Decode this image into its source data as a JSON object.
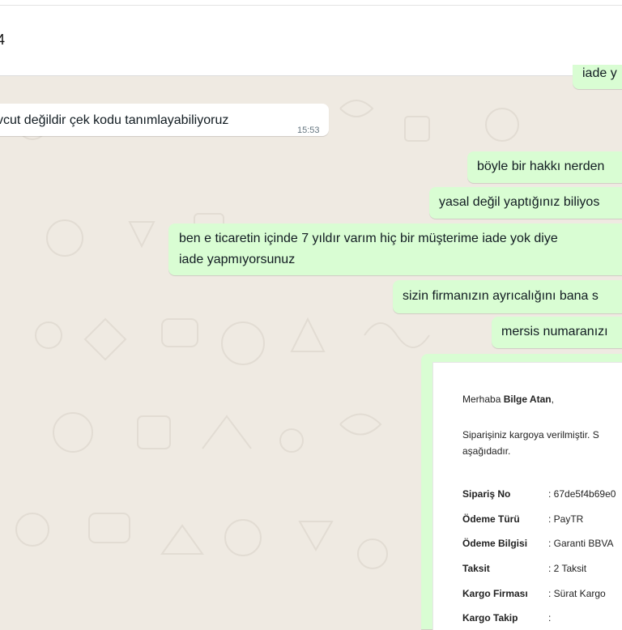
{
  "header": {
    "title": "4"
  },
  "colors": {
    "outgoing": "#d9fdd3",
    "incoming": "#ffffff",
    "wallpaper": "#efeae2"
  },
  "messages": [
    {
      "direction": "out",
      "text": "iade y"
    },
    {
      "direction": "in",
      "text": "vcut değildir çek kodu tanımlayabiliyoruz",
      "time": "15:53"
    },
    {
      "direction": "out",
      "text": "böyle bir hakkı nerden"
    },
    {
      "direction": "out",
      "text": "yasal değil yaptığınız biliyos"
    },
    {
      "direction": "out",
      "line1": "ben e ticaretin içinde 7 yıldır varım hiç bir müşterime iade yok diye",
      "line2": "iade yapmıyorsunuz"
    },
    {
      "direction": "out",
      "text": "sizin firmanızın ayrıcalığını bana s"
    },
    {
      "direction": "out",
      "text": "mersis numaranızı"
    }
  ],
  "email": {
    "greeting_prefix": "Merhaba ",
    "greeting_name": "Bilge Atan",
    "greeting_suffix": ",",
    "notice_line1": "Siparişiniz kargoya verilmiştir. S",
    "notice_line2": "aşağıdadır.",
    "rows": [
      {
        "label": "Sipariş No",
        "value": ": 67de5f4b69e0"
      },
      {
        "label": "Ödeme Türü",
        "value": ": PayTR"
      },
      {
        "label": "Ödeme Bilgisi",
        "value": ": Garanti BBVA"
      },
      {
        "label": "Taksit",
        "value": ": 2 Taksit"
      },
      {
        "label": "Kargo Firması",
        "value": ": Sürat Kargo"
      },
      {
        "label": "Kargo Takip",
        "value": ":"
      }
    ]
  }
}
